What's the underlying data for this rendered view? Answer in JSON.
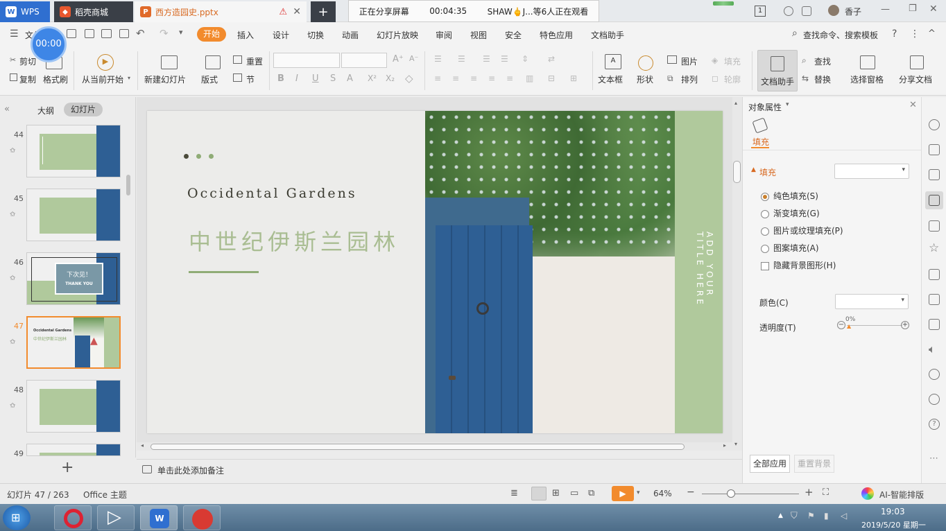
{
  "titlebar": {
    "app_tab": "WPS",
    "tab2": "稻壳商城",
    "tab3": "西方造园史.pptx",
    "add_tab": "+",
    "user_name": "香子",
    "window_number": "1"
  },
  "share": {
    "status": "正在分享屏幕",
    "timer": "00:04:35",
    "viewers": "SHAW🖕J...等6人正在观看"
  },
  "timer_bubble": "00:00",
  "menubar": {
    "file": "文件",
    "items": [
      "开始",
      "插入",
      "设计",
      "切换",
      "动画",
      "幻灯片放映",
      "审阅",
      "视图",
      "安全",
      "特色应用",
      "文档助手"
    ],
    "search": "查找命令、搜索模板",
    "help": "?",
    "more": "⋮",
    "collapse": "^"
  },
  "ribbon": {
    "cut": "剪切",
    "copy": "复制",
    "format_painter": "格式刷",
    "from_current": "从当前开始",
    "new_slide": "新建幻灯片",
    "layout": "版式",
    "reset": "重置",
    "section": "节",
    "text_box": "文本框",
    "shape": "形状",
    "picture": "图片",
    "arrange": "排列",
    "fill": "填充",
    "outline": "轮廓",
    "doc_assistant": "文档助手",
    "find": "查找",
    "replace": "替换",
    "selection_pane": "选择窗格",
    "share_doc": "分享文档"
  },
  "leftpanel": {
    "outline_tab": "大纲",
    "slides_tab": "幻灯片",
    "slide_numbers": [
      "44",
      "45",
      "46",
      "47",
      "48",
      "49"
    ],
    "thumb46_text": "下次见！",
    "thumb46_sub": "THANK YOU",
    "thumb47_title": "Occidental Gardens",
    "thumb47_sub": "中世纪伊斯兰园林",
    "add": "+"
  },
  "slide": {
    "title_en": "Occidental Gardens",
    "title_cn": "中世纪伊斯兰园林",
    "side_text": "ADD YOUR TITLE HERE",
    "accent_green": "#8fac76",
    "side_green": "#b0c99c",
    "door_blue": "#2e5f94"
  },
  "notes": "单击此处添加备注",
  "properties": {
    "header": "对象属性",
    "fill_tab": "填充",
    "fill_section": "填充",
    "options": [
      "纯色填充(S)",
      "渐变填充(G)",
      "图片或纹理填充(P)",
      "图案填充(A)"
    ],
    "hide_bg": "隐藏背景图形(H)",
    "color_label": "颜色(C)",
    "transparency_label": "透明度(T)",
    "transparency_value": "0%",
    "apply_all": "全部应用",
    "reset_bg": "重置背景"
  },
  "statusbar": {
    "slide_info": "幻灯片 47 / 263",
    "theme": "Office 主题",
    "zoom": "64%",
    "ai": "AI-智能排版"
  },
  "taskbar": {
    "time": "19:03",
    "date": "2019/5/20 星期一"
  },
  "colors": {
    "accent_orange": "#f28b2d",
    "wps_red": "#d93a32"
  }
}
